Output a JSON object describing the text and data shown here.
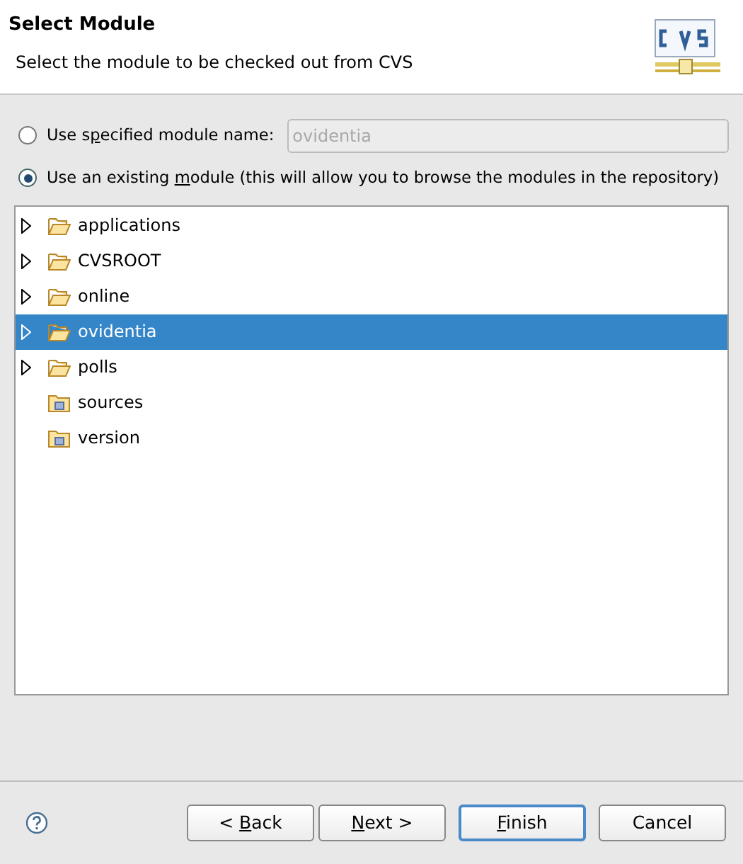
{
  "header": {
    "title": "Select Module",
    "description": "Select the module to be checked out from CVS"
  },
  "options": [
    {
      "label": "Use specified module name:",
      "selected": false,
      "kind": "field",
      "field_value": "ovidentia",
      "field_disabled": true
    },
    {
      "label": "Use an existing module (this will allow you to browse the modules in the repository)",
      "selected": true,
      "kind": "plain"
    }
  ],
  "tree": [
    {
      "label": "applications",
      "expandable": true,
      "selected": false
    },
    {
      "label": "CVSROOT",
      "expandable": true,
      "selected": false
    },
    {
      "label": "online",
      "expandable": true,
      "selected": false
    },
    {
      "label": "ovidentia",
      "expandable": true,
      "selected": true
    },
    {
      "label": "polls",
      "expandable": true,
      "selected": false
    },
    {
      "label": "sources",
      "expandable": false,
      "selected": false
    },
    {
      "label": "version",
      "expandable": false,
      "selected": false
    }
  ],
  "buttons": [
    {
      "label": "< Back",
      "default": false
    },
    {
      "label": "Next >",
      "default": false
    },
    {
      "label": "Finish",
      "default": true
    },
    {
      "label": "Cancel",
      "default": false
    }
  ]
}
